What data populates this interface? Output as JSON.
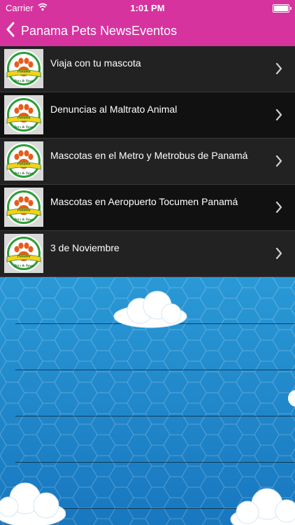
{
  "status": {
    "carrier": "Carrier",
    "time": "1:01 PM"
  },
  "nav": {
    "title": "Panama Pets NewsEventos"
  },
  "colors": {
    "accent": "#d6339f",
    "row_dark": "#111111",
    "row_light": "#222222",
    "sky_blue": "#1a7fc7"
  },
  "rows": [
    {
      "label": "Viaja con tu mascota"
    },
    {
      "label": "Denuncias al Maltrato Animal"
    },
    {
      "label": "Mascotas en el Metro y Metrobus de Panamá"
    },
    {
      "label": "Mascotas en Aeropuerto Tocumen Panamá"
    },
    {
      "label": "3 de Noviembre"
    }
  ],
  "logo": {
    "top_text": "Panama",
    "bottom_text": "Pet s & News"
  }
}
